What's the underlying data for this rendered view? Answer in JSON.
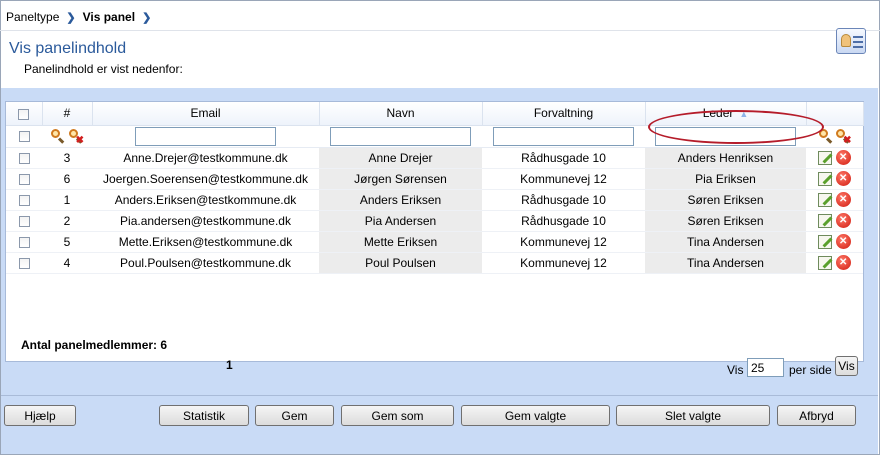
{
  "breadcrumb": {
    "items": [
      "Paneltype",
      "Vis panel"
    ]
  },
  "page": {
    "title": "Vis panelindhold",
    "subtitle": "Panelindhold er vist nedenfor:"
  },
  "table": {
    "columns": {
      "num": "#",
      "email": "Email",
      "navn": "Navn",
      "forvaltning": "Forvaltning",
      "leder": "Leder"
    },
    "sort": {
      "column": "Leder",
      "direction": "ascending"
    },
    "rows": [
      {
        "num": "3",
        "email": "Anne.Drejer@testkommune.dk",
        "navn": "Anne Drejer",
        "forvaltning": "Rådhusgade 10",
        "leder": "Anders Henriksen"
      },
      {
        "num": "6",
        "email": "Joergen.Soerensen@testkommune.dk",
        "navn": "Jørgen Sørensen",
        "forvaltning": "Kommunevej 12",
        "leder": "Pia Eriksen"
      },
      {
        "num": "1",
        "email": "Anders.Eriksen@testkommune.dk",
        "navn": "Anders Eriksen",
        "forvaltning": "Rådhusgade 10",
        "leder": "Søren Eriksen"
      },
      {
        "num": "2",
        "email": "Pia.andersen@testkommune.dk",
        "navn": "Pia Andersen",
        "forvaltning": "Rådhusgade 10",
        "leder": "Søren Eriksen"
      },
      {
        "num": "5",
        "email": "Mette.Eriksen@testkommune.dk",
        "navn": "Mette Eriksen",
        "forvaltning": "Kommunevej 12",
        "leder": "Tina Andersen"
      },
      {
        "num": "4",
        "email": "Poul.Poulsen@testkommune.dk",
        "navn": "Poul Poulsen",
        "forvaltning": "Kommunevej 12",
        "leder": "Tina Andersen"
      }
    ]
  },
  "footer": {
    "count_label": "Antal panelmedlemmer:",
    "count_value": "6",
    "page_number": "1",
    "vis_label": "Vis",
    "per_page_value": "25",
    "per_side_label": "per side",
    "vis_button": "Vis"
  },
  "buttons": {
    "help": "Hjælp",
    "statistik": "Statistik",
    "gem": "Gem",
    "gem_som": "Gem som",
    "gem_valgte": "Gem valgte",
    "slet_valgte": "Slet valgte",
    "afbryd": "Afbryd"
  },
  "icons": {
    "header": "contact-card-icon",
    "search": "search-icon",
    "clear_search": "clear-search-icon",
    "edit": "edit-icon",
    "delete": "delete-icon",
    "sort": "sort-ascending-icon"
  },
  "colors": {
    "accent": "#2b5a9b",
    "panel_bg": "#c9dbf6",
    "highlight_oval": "#b51c2a",
    "delete": "#d01a0e"
  }
}
